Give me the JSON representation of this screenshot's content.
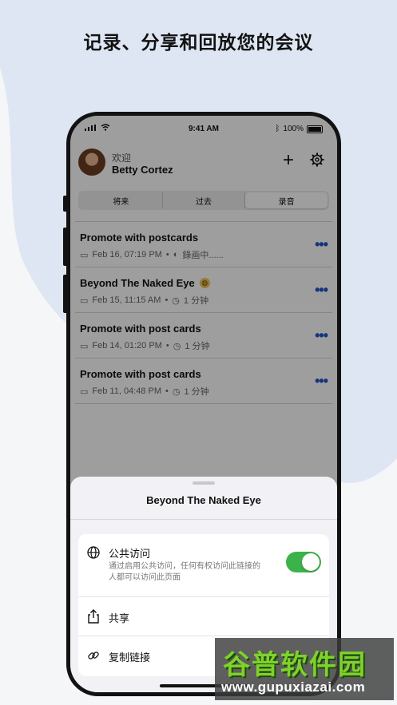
{
  "headline": "记录、分享和回放您的会议",
  "status_bar": {
    "time": "9:41 AM",
    "battery": "100%"
  },
  "header": {
    "greeting": "欢迎",
    "user_name": "Betty Cortez"
  },
  "tabs": [
    {
      "label": "将来"
    },
    {
      "label": "过去"
    },
    {
      "label": "录音"
    }
  ],
  "meetings": [
    {
      "title": "Promote with postcards",
      "date": "Feb 16, 07:19 PM",
      "status": "錄画中......",
      "public": false
    },
    {
      "title": "Beyond The Naked Eye",
      "date": "Feb 15, 11:15 AM",
      "status": "1 分钟",
      "public": true
    },
    {
      "title": "Promote with post cards",
      "date": "Feb 14, 01:20 PM",
      "status": "1 分钟",
      "public": false
    },
    {
      "title": "Promote with post cards",
      "date": "Feb 11, 04:48 PM",
      "status": "1 分钟",
      "public": false
    }
  ],
  "sheet": {
    "title": "Beyond The Naked Eye",
    "public_access": {
      "label": "公共访问",
      "description": "通过启用公共访问，任何有权访问此链接的人都可以访问此页面",
      "enabled": true
    },
    "share_label": "共享",
    "copy_link_label": "复制链接"
  },
  "watermark": {
    "main": "谷普软件园",
    "url": "www.gupuxiazai.com"
  },
  "colors": {
    "accent": "#2154c9",
    "toggle_on": "#3cb24a",
    "background_blob": "#dfe6f3"
  },
  "icons": [
    "signal-icon",
    "wifi-icon",
    "bluetooth-icon",
    "battery-icon",
    "plus-icon",
    "gear-icon",
    "calendar-icon",
    "recording-icon",
    "clock-icon",
    "globe-icon",
    "more-icon",
    "share-icon",
    "link-icon"
  ]
}
